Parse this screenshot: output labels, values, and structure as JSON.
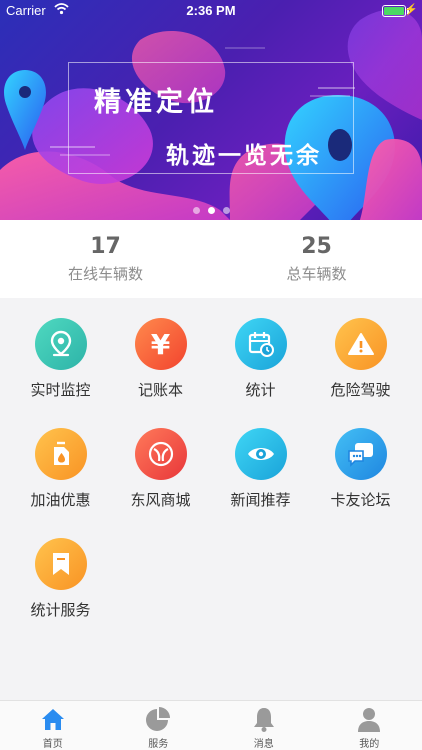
{
  "status": {
    "carrier": "Carrier",
    "time": "2:36 PM"
  },
  "banner": {
    "title": "精准定位",
    "subtitle": "轨迹一览无余",
    "page_count": 3,
    "active_page": 2
  },
  "stats": [
    {
      "value": "17",
      "label": "在线车辆数"
    },
    {
      "value": "25",
      "label": "总车辆数"
    }
  ],
  "grid": [
    {
      "label": "实时监控",
      "icon": "location-pin-icon",
      "color": "#39c7b4"
    },
    {
      "label": "记账本",
      "icon": "yen-icon",
      "color": "#f86a3c"
    },
    {
      "label": "统计",
      "icon": "calendar-clock-icon",
      "color": "#1fb7e6"
    },
    {
      "label": "危险驾驶",
      "icon": "warning-icon",
      "color": "#fba737"
    },
    {
      "label": "加油优惠",
      "icon": "fuel-can-icon",
      "color": "#fba737"
    },
    {
      "label": "东风商城",
      "icon": "dongfeng-logo-icon",
      "color": "#f55b47"
    },
    {
      "label": "新闻推荐",
      "icon": "eye-icon",
      "color": "#1fb7e6"
    },
    {
      "label": "卡友论坛",
      "icon": "chat-bubbles-icon",
      "color": "#2aa6ea"
    },
    {
      "label": "统计服务",
      "icon": "bookmark-icon",
      "color": "#fba737"
    }
  ],
  "tabs": [
    {
      "label": "首页",
      "icon": "home-icon",
      "active": true
    },
    {
      "label": "服务",
      "icon": "pie-chart-icon",
      "active": false
    },
    {
      "label": "消息",
      "icon": "bell-icon",
      "active": false
    },
    {
      "label": "我的",
      "icon": "person-icon",
      "active": false
    }
  ],
  "colors": {
    "accent": "#2a8cf0",
    "inactive_tab": "#9a9a9a"
  }
}
